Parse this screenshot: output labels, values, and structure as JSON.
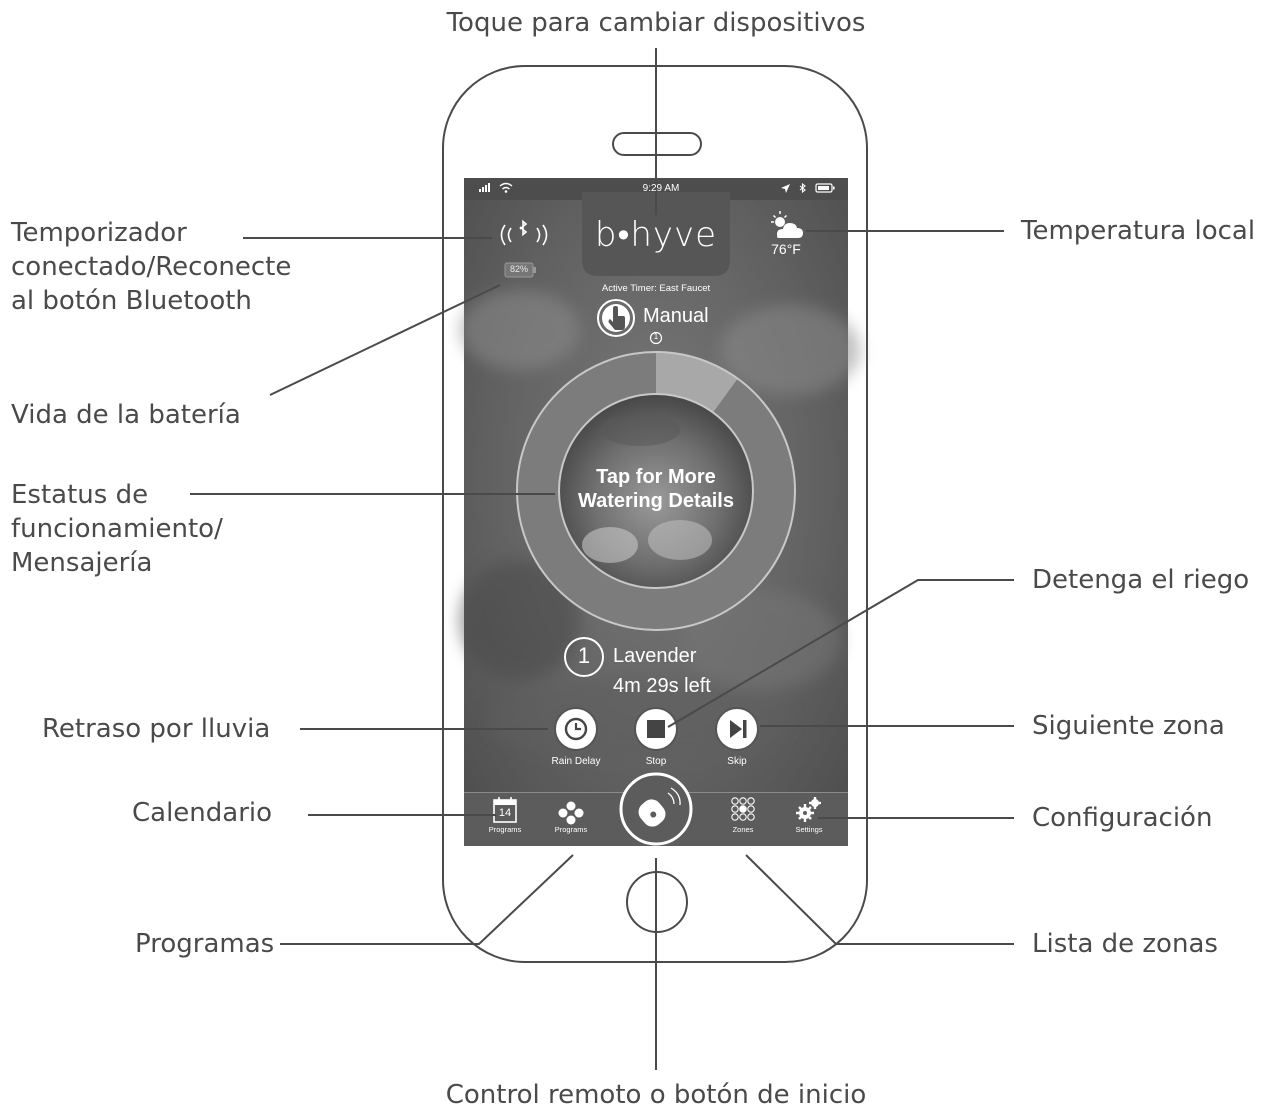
{
  "callouts": {
    "top": "Toque para cambiar dispositivos",
    "timer_line1": "Temporizador",
    "timer_line2": "conectado/Reconecte",
    "timer_line3": "al botón Bluetooth",
    "battery": "Vida de la batería",
    "status_line1": "Estatus de",
    "status_line2": "funcionamiento/",
    "status_line3": "Mensajería",
    "rain_delay": "Retraso por lluvia",
    "calendar": "Calendario",
    "programs": "Programas",
    "temperature": "Temperatura local",
    "stop": "Detenga el riego",
    "next_zone": "Siguiente zona",
    "settings": "Configuración",
    "zones_list": "Lista de zonas",
    "remote": "Control remoto o botón de inicio"
  },
  "phone": {
    "status_bar": {
      "time": "9:29 AM"
    },
    "logo": "b•hyve",
    "battery_percent": "82%",
    "weather": {
      "temp": "76°F",
      "icon": "partly-sunny-icon"
    },
    "active_timer": "Active Timer: East Faucet",
    "mode": "Manual",
    "mode_index": "1",
    "ring": {
      "progress": 0.1,
      "center_line1": "Tap for More",
      "center_line2": "Watering Details"
    },
    "zone": {
      "number": "1",
      "name": "Lavender",
      "time_left": "4m 29s left"
    },
    "actions": [
      {
        "label": "Rain Delay",
        "icon": "clock-icon"
      },
      {
        "label": "Stop",
        "icon": "stop-icon"
      },
      {
        "label": "Skip",
        "icon": "skip-icon"
      }
    ],
    "tabbar": {
      "calendar_label": "Programs",
      "calendar_day": "14",
      "programs_label": "Programs",
      "zones_label": "Zones",
      "settings_label": "Settings"
    }
  }
}
